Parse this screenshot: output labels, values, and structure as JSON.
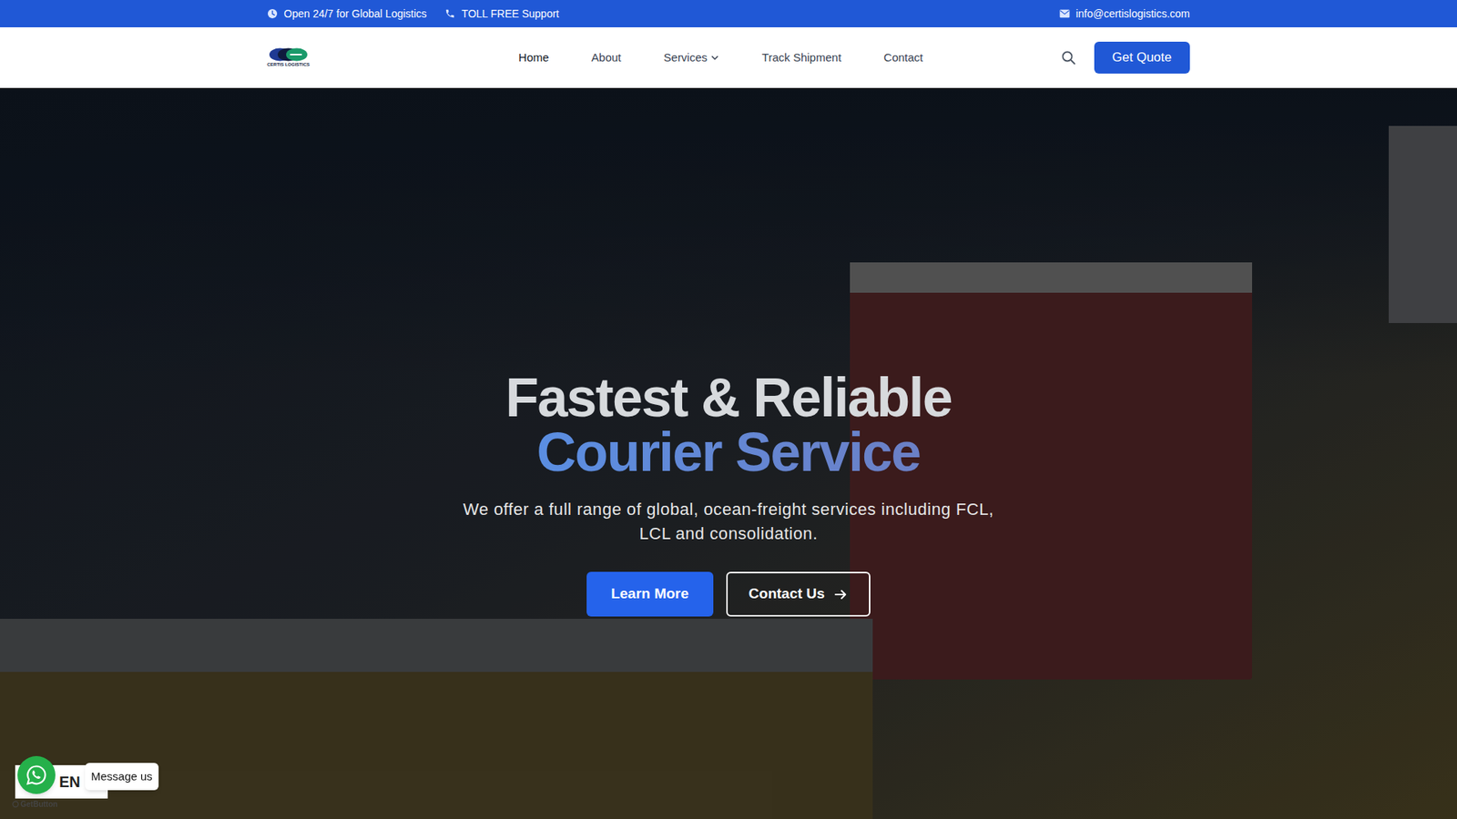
{
  "top_bar": {
    "hours": "Open 24/7 for Global Logistics",
    "phone": "TOLL FREE Support",
    "email": "info@certislogistics.com"
  },
  "logo": {
    "text": "CERTIS LOGISTICS"
  },
  "nav": {
    "items": [
      {
        "label": "Home",
        "selected": true,
        "has_dropdown": false
      },
      {
        "label": "About",
        "selected": false,
        "has_dropdown": false
      },
      {
        "label": "Services",
        "selected": false,
        "has_dropdown": true
      },
      {
        "label": "Track Shipment",
        "selected": false,
        "has_dropdown": false
      },
      {
        "label": "Contact",
        "selected": false,
        "has_dropdown": false
      }
    ]
  },
  "get_quote": "Get Quote",
  "hero": {
    "title": "Fastest & Reliable",
    "highlight": "Courier Service",
    "subtitle": "We offer a full range of global, ocean-freight services including FCL, LCL and consolidation.",
    "buttons": [
      {
        "label": "Learn More",
        "kind": "solid"
      },
      {
        "label": "Contact Us",
        "kind": "outline"
      }
    ]
  },
  "widgets": {
    "language": "EN",
    "chat_tooltip": "Message us",
    "brand": "GetButton"
  }
}
